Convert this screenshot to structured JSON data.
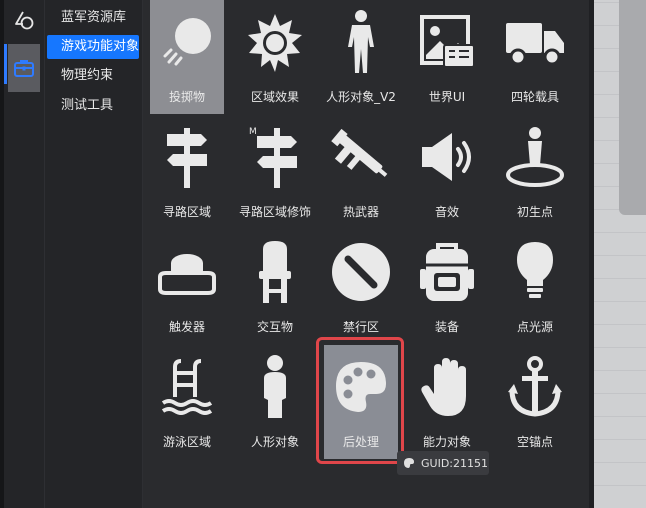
{
  "left_rail": {
    "items": [
      {
        "icon": "shapes-icon"
      },
      {
        "icon": "toolbox-icon",
        "active": true
      }
    ]
  },
  "categories": [
    {
      "label": "蓝军资源库"
    },
    {
      "label": "游戏功能对象",
      "selected": true
    },
    {
      "label": "物理约束"
    },
    {
      "label": "测试工具"
    }
  ],
  "grid": {
    "items": [
      {
        "label": "投掷物",
        "icon": "throwable-icon",
        "state": "selected"
      },
      {
        "label": "区域效果",
        "icon": "sun-area-icon"
      },
      {
        "label": "人形对象_V2",
        "icon": "humanoid-v2-icon"
      },
      {
        "label": "世界UI",
        "icon": "world-ui-icon"
      },
      {
        "label": "四轮载具",
        "icon": "truck-icon"
      },
      {
        "label": "寻路区域",
        "icon": "signpost-icon"
      },
      {
        "label": "寻路区域修饰",
        "icon": "signpost-modifier-icon"
      },
      {
        "label": "热武器",
        "icon": "gun-icon"
      },
      {
        "label": "音效",
        "icon": "speaker-icon"
      },
      {
        "label": "初生点",
        "icon": "spawn-point-icon"
      },
      {
        "label": "触发器",
        "icon": "trigger-button-icon"
      },
      {
        "label": "交互物",
        "icon": "chair-icon"
      },
      {
        "label": "禁行区",
        "icon": "no-entry-icon"
      },
      {
        "label": "装备",
        "icon": "backpack-icon"
      },
      {
        "label": "点光源",
        "icon": "light-bulb-icon"
      },
      {
        "label": "游泳区域",
        "icon": "pool-ladder-icon"
      },
      {
        "label": "人形对象",
        "icon": "humanoid-icon"
      },
      {
        "label": "后处理",
        "icon": "palette-icon",
        "state": "hover"
      },
      {
        "label": "能力对象",
        "icon": "hand-icon"
      },
      {
        "label": "空锚点",
        "icon": "anchor-icon"
      }
    ]
  },
  "tooltip": {
    "text": "GUID:21151",
    "icon": "palette-small-icon"
  },
  "colors": {
    "accent": "#1677ff",
    "hover_ring": "#e0464a",
    "icon_fill": "#e9e9e9",
    "selected_tile": "#8d8e93"
  }
}
